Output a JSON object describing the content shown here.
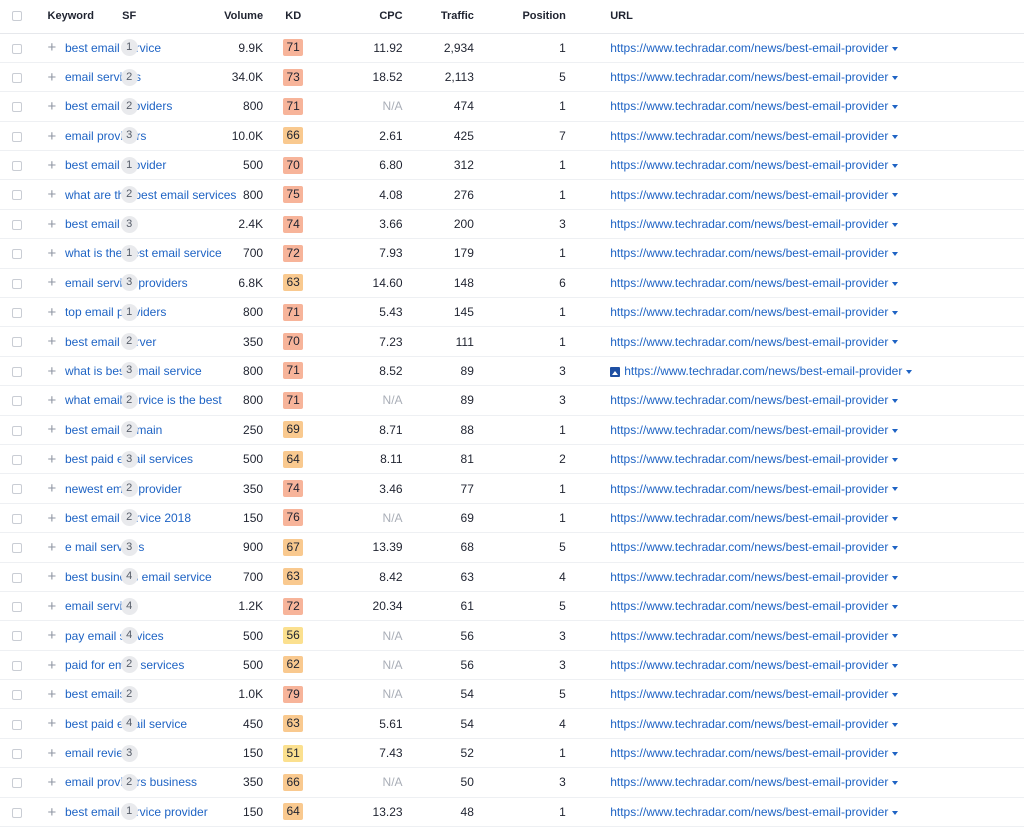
{
  "headers": {
    "keyword": "Keyword",
    "sf": "SF",
    "volume": "Volume",
    "kd": "KD",
    "cpc": "CPC",
    "traffic": "Traffic",
    "position": "Position",
    "url": "URL"
  },
  "colors": {
    "link": "#1e63c4",
    "kd_hard": "#f7b49a",
    "kd_mid": "#f9c98f",
    "kd_low": "#fbe08f",
    "na_text": "#a9aeb7"
  },
  "rows": [
    {
      "keyword": "best email service",
      "sf": "1",
      "volume": "9.9K",
      "kd": "71",
      "kd_level": "hard",
      "cpc": "11.92",
      "traffic": "2,934",
      "position": "1",
      "url": "https://www.techradar.com/news/best-email-provider",
      "url_icon": ""
    },
    {
      "keyword": "email services",
      "sf": "2",
      "volume": "34.0K",
      "kd": "73",
      "kd_level": "hard",
      "cpc": "18.52",
      "traffic": "2,113",
      "position": "5",
      "url": "https://www.techradar.com/news/best-email-provider",
      "url_icon": ""
    },
    {
      "keyword": "best email providers",
      "sf": "2",
      "volume": "800",
      "kd": "71",
      "kd_level": "hard",
      "cpc": "N/A",
      "traffic": "474",
      "position": "1",
      "url": "https://www.techradar.com/news/best-email-provider",
      "url_icon": ""
    },
    {
      "keyword": "email providers",
      "sf": "3",
      "volume": "10.0K",
      "kd": "66",
      "kd_level": "mid",
      "cpc": "2.61",
      "traffic": "425",
      "position": "7",
      "url": "https://www.techradar.com/news/best-email-provider",
      "url_icon": ""
    },
    {
      "keyword": "best email provider",
      "sf": "1",
      "volume": "500",
      "kd": "70",
      "kd_level": "hard",
      "cpc": "6.80",
      "traffic": "312",
      "position": "1",
      "url": "https://www.techradar.com/news/best-email-provider",
      "url_icon": ""
    },
    {
      "keyword": "what are the best email services",
      "sf": "2",
      "volume": "800",
      "kd": "75",
      "kd_level": "hard",
      "cpc": "4.08",
      "traffic": "276",
      "position": "1",
      "url": "https://www.techradar.com/news/best-email-provider",
      "url_icon": ""
    },
    {
      "keyword": "best email",
      "sf": "3",
      "volume": "2.4K",
      "kd": "74",
      "kd_level": "hard",
      "cpc": "3.66",
      "traffic": "200",
      "position": "3",
      "url": "https://www.techradar.com/news/best-email-provider",
      "url_icon": ""
    },
    {
      "keyword": "what is the best email service",
      "sf": "1",
      "volume": "700",
      "kd": "72",
      "kd_level": "hard",
      "cpc": "7.93",
      "traffic": "179",
      "position": "1",
      "url": "https://www.techradar.com/news/best-email-provider",
      "url_icon": ""
    },
    {
      "keyword": "email service providers",
      "sf": "3",
      "volume": "6.8K",
      "kd": "63",
      "kd_level": "mid",
      "cpc": "14.60",
      "traffic": "148",
      "position": "6",
      "url": "https://www.techradar.com/news/best-email-provider",
      "url_icon": ""
    },
    {
      "keyword": "top email providers",
      "sf": "1",
      "volume": "800",
      "kd": "71",
      "kd_level": "hard",
      "cpc": "5.43",
      "traffic": "145",
      "position": "1",
      "url": "https://www.techradar.com/news/best-email-provider",
      "url_icon": ""
    },
    {
      "keyword": "best email server",
      "sf": "2",
      "volume": "350",
      "kd": "70",
      "kd_level": "hard",
      "cpc": "7.23",
      "traffic": "111",
      "position": "1",
      "url": "https://www.techradar.com/news/best-email-provider",
      "url_icon": ""
    },
    {
      "keyword": "what is best email service",
      "sf": "3",
      "volume": "800",
      "kd": "71",
      "kd_level": "hard",
      "cpc": "8.52",
      "traffic": "89",
      "position": "3",
      "url": "https://www.techradar.com/news/best-email-provider",
      "url_icon": "image-icon"
    },
    {
      "keyword": "what email service is the best",
      "sf": "2",
      "volume": "800",
      "kd": "71",
      "kd_level": "hard",
      "cpc": "N/A",
      "traffic": "89",
      "position": "3",
      "url": "https://www.techradar.com/news/best-email-provider",
      "url_icon": ""
    },
    {
      "keyword": "best email domain",
      "sf": "2",
      "volume": "250",
      "kd": "69",
      "kd_level": "mid",
      "cpc": "8.71",
      "traffic": "88",
      "position": "1",
      "url": "https://www.techradar.com/news/best-email-provider",
      "url_icon": ""
    },
    {
      "keyword": "best paid email services",
      "sf": "3",
      "volume": "500",
      "kd": "64",
      "kd_level": "mid",
      "cpc": "8.11",
      "traffic": "81",
      "position": "2",
      "url": "https://www.techradar.com/news/best-email-provider",
      "url_icon": ""
    },
    {
      "keyword": "newest email provider",
      "sf": "2",
      "volume": "350",
      "kd": "74",
      "kd_level": "hard",
      "cpc": "3.46",
      "traffic": "77",
      "position": "1",
      "url": "https://www.techradar.com/news/best-email-provider",
      "url_icon": ""
    },
    {
      "keyword": "best email service 2018",
      "sf": "2",
      "volume": "150",
      "kd": "76",
      "kd_level": "hard",
      "cpc": "N/A",
      "traffic": "69",
      "position": "1",
      "url": "https://www.techradar.com/news/best-email-provider",
      "url_icon": ""
    },
    {
      "keyword": "e mail services",
      "sf": "3",
      "volume": "900",
      "kd": "67",
      "kd_level": "mid",
      "cpc": "13.39",
      "traffic": "68",
      "position": "5",
      "url": "https://www.techradar.com/news/best-email-provider",
      "url_icon": ""
    },
    {
      "keyword": "best business email service",
      "sf": "4",
      "volume": "700",
      "kd": "63",
      "kd_level": "mid",
      "cpc": "8.42",
      "traffic": "63",
      "position": "4",
      "url": "https://www.techradar.com/news/best-email-provider",
      "url_icon": ""
    },
    {
      "keyword": "email service",
      "sf": "4",
      "volume": "1.2K",
      "kd": "72",
      "kd_level": "hard",
      "cpc": "20.34",
      "traffic": "61",
      "position": "5",
      "url": "https://www.techradar.com/news/best-email-provider",
      "url_icon": ""
    },
    {
      "keyword": "pay email services",
      "sf": "4",
      "volume": "500",
      "kd": "56",
      "kd_level": "low",
      "cpc": "N/A",
      "traffic": "56",
      "position": "3",
      "url": "https://www.techradar.com/news/best-email-provider",
      "url_icon": ""
    },
    {
      "keyword": "paid for email services",
      "sf": "2",
      "volume": "500",
      "kd": "62",
      "kd_level": "mid",
      "cpc": "N/A",
      "traffic": "56",
      "position": "3",
      "url": "https://www.techradar.com/news/best-email-provider",
      "url_icon": ""
    },
    {
      "keyword": "best emails",
      "sf": "2",
      "volume": "1.0K",
      "kd": "79",
      "kd_level": "hard",
      "cpc": "N/A",
      "traffic": "54",
      "position": "5",
      "url": "https://www.techradar.com/news/best-email-provider",
      "url_icon": ""
    },
    {
      "keyword": "best paid email service",
      "sf": "4",
      "volume": "450",
      "kd": "63",
      "kd_level": "mid",
      "cpc": "5.61",
      "traffic": "54",
      "position": "4",
      "url": "https://www.techradar.com/news/best-email-provider",
      "url_icon": ""
    },
    {
      "keyword": "email reviews",
      "sf": "3",
      "volume": "150",
      "kd": "51",
      "kd_level": "low",
      "cpc": "7.43",
      "traffic": "52",
      "position": "1",
      "url": "https://www.techradar.com/news/best-email-provider",
      "url_icon": ""
    },
    {
      "keyword": "email providers business",
      "sf": "2",
      "volume": "350",
      "kd": "66",
      "kd_level": "mid",
      "cpc": "N/A",
      "traffic": "50",
      "position": "3",
      "url": "https://www.techradar.com/news/best-email-provider",
      "url_icon": ""
    },
    {
      "keyword": "best email service provider",
      "sf": "1",
      "volume": "150",
      "kd": "64",
      "kd_level": "mid",
      "cpc": "13.23",
      "traffic": "48",
      "position": "1",
      "url": "https://www.techradar.com/news/best-email-provider",
      "url_icon": ""
    }
  ]
}
